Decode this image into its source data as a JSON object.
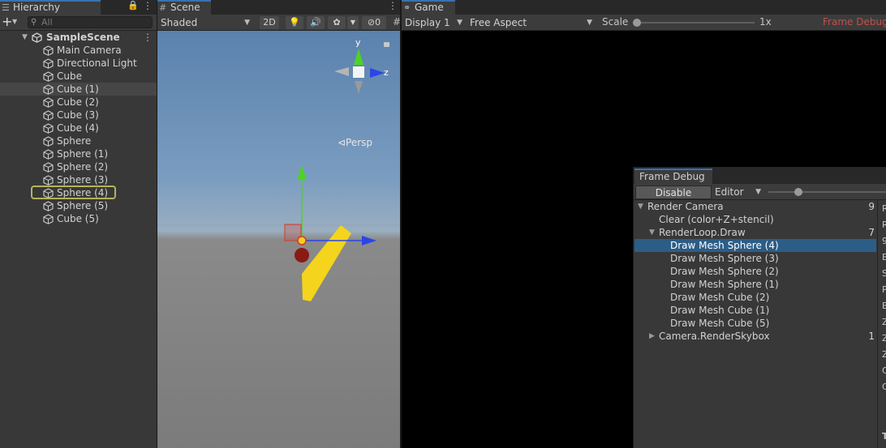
{
  "hierarchy": {
    "tab": "Hierarchy",
    "add_label": "+",
    "search_placeholder": "All",
    "scene_name": "SampleScene",
    "items": [
      "Main Camera",
      "Directional Light",
      "Cube",
      "Cube (1)",
      "Cube (2)",
      "Cube (3)",
      "Cube (4)",
      "Sphere",
      "Sphere (1)",
      "Sphere (2)",
      "Sphere (3)",
      "Sphere (4)",
      "Sphere (5)",
      "Cube (5)"
    ],
    "selected_item": "Cube (1)",
    "outlined_item": "Sphere (4)"
  },
  "scene": {
    "tab": "Scene",
    "shading_mode": "Shaded",
    "mode_2d": "2D",
    "hidden_count": "0",
    "gizmo_y": "y",
    "gizmo_z": "z",
    "persp_label": "⊲Persp",
    "sphere_color": "#8a1a14",
    "object_color": "#f4d41c"
  },
  "game": {
    "tab": "Game",
    "display": "Display 1",
    "aspect": "Free Aspect",
    "scale_label": "Scale",
    "scale_value": "1x",
    "frame_debug_label": "Frame Debug"
  },
  "frame_debug": {
    "tab": "Frame Debug",
    "disable_label": "Disable",
    "target": "Editor",
    "events": [
      {
        "label": "Render Camera",
        "indent": 0,
        "expand": "open",
        "count": "9"
      },
      {
        "label": "Clear (color+Z+stencil)",
        "indent": 1,
        "expand": "",
        "count": ""
      },
      {
        "label": "RenderLoop.Draw",
        "indent": 1,
        "expand": "open",
        "count": "7"
      },
      {
        "label": "Draw Mesh Sphere (4)",
        "indent": 2,
        "expand": "",
        "count": "",
        "selected": true
      },
      {
        "label": "Draw Mesh Sphere (3)",
        "indent": 2,
        "expand": "",
        "count": ""
      },
      {
        "label": "Draw Mesh Sphere (2)",
        "indent": 2,
        "expand": "",
        "count": ""
      },
      {
        "label": "Draw Mesh Sphere (1)",
        "indent": 2,
        "expand": "",
        "count": ""
      },
      {
        "label": "Draw Mesh Cube (2)",
        "indent": 2,
        "expand": "",
        "count": ""
      },
      {
        "label": "Draw Mesh Cube (1)",
        "indent": 2,
        "expand": "",
        "count": ""
      },
      {
        "label": "Draw Mesh Cube (5)",
        "indent": 2,
        "expand": "",
        "count": ""
      },
      {
        "label": "Camera.RenderSkybox",
        "indent": 1,
        "expand": "closed",
        "count": "1"
      }
    ],
    "detail_letters": [
      "R",
      "R",
      "9",
      "E",
      "S",
      "P",
      "B",
      "Z",
      "Z",
      "Z",
      "C",
      "C"
    ],
    "footer_letter": "T"
  },
  "colors": {
    "selection": "#2c5d87",
    "tab_accent": "#3a72b0",
    "frame_debug_red": "#c0504a",
    "outline": "#b4b35a"
  }
}
